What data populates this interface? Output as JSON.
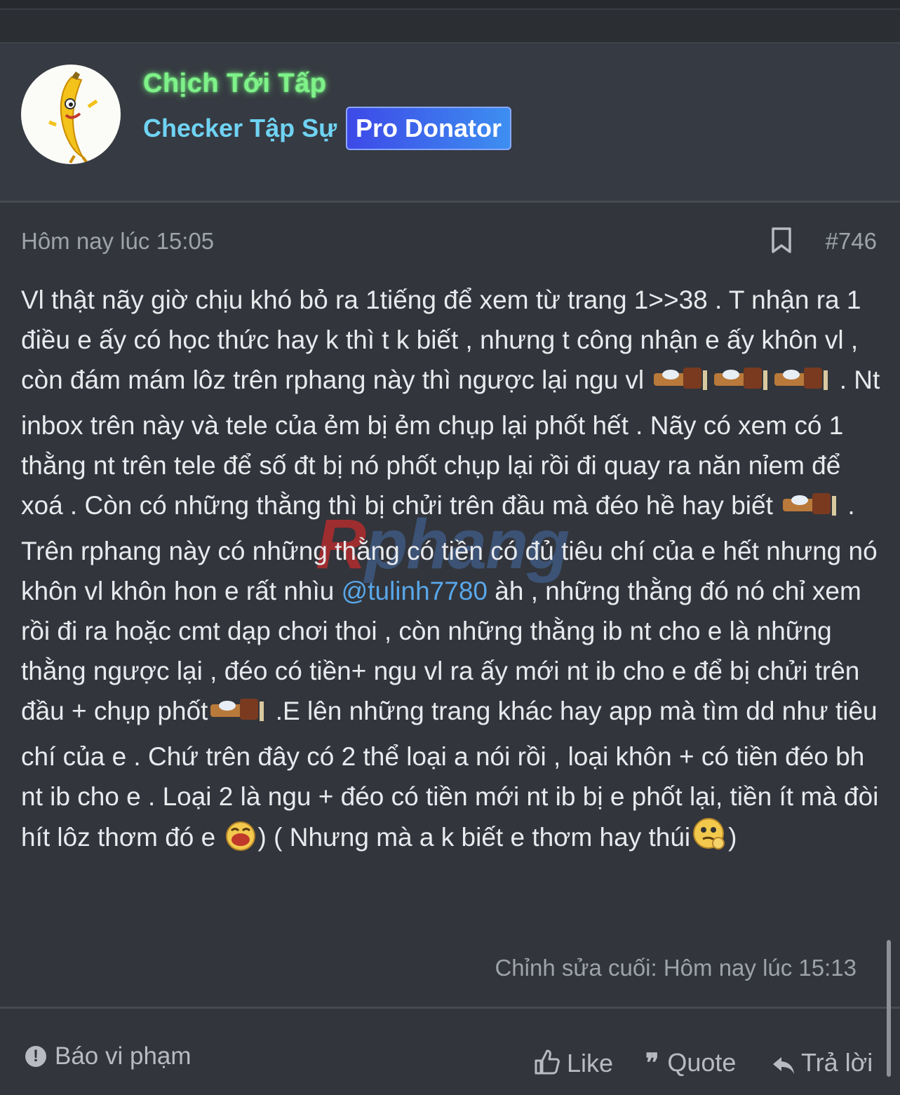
{
  "post": {
    "author": {
      "name": "Chịch Tới Tấp",
      "title": "Checker Tập Sự",
      "badge": "Pro Donator"
    },
    "date": "Hôm nay lúc 15:05",
    "number": "#746",
    "message": {
      "p1": "Vl thật nãy giờ chịu khó bỏ ra 1tiếng để xem từ trang 1>>38 . T nhận ra 1 điều e ấy có học thức hay k thì t k biết , nhưng t công nhận e ấy khôn vl , còn đám mám lôz trên rphang này thì ngược lại ngu vl",
      "p2": " . Nt inbox trên này và tele của ẻm bị ẻm chụp lại phốt hết . Nãy có xem có 1 thằng nt trên tele để số đt bị nó phốt chụp lại rồi đi quay ra năn nỉem để xoá . Còn có những thằng thì bị chửi trên đầu mà đéo hề hay biết",
      "p3": " . Trên rphang này có những thằng có tiền có đủ tiêu chí của e hết nhưng nó khôn vl khôn hon e rất nhìu ",
      "mention": "@tulinh7780",
      "p4": " àh , những thằng đó nó chỉ xem rồi đi ra hoặc cmt dạp chơi thoi , còn những thằng ib nt cho e là những thằng ngược lại , đéo có tiền+ ngu vl ra ấy mới nt ib cho e để bị chửi trên đầu + chụp phốt",
      "p5": " .E lên những trang khác hay app mà tìm dd như tiêu chí của e . Chứ trên đây có 2 thể loại a nói rồi , loại khôn + có tiền đéo bh nt ib cho e . Loại 2 là ngu + đéo có tiền mới nt ib bị e phốt lại, tiền ít mà đòi hít lôz thơm đó e ",
      "p6": ") ( Nhưng mà a k biết e thơm hay thúi",
      "p7": ")"
    },
    "edited": "Chỉnh sửa cuối: Hôm nay lúc 15:13"
  },
  "watermark": {
    "first": "R",
    "rest": "phang"
  },
  "footer": {
    "report_icon": "!",
    "report": "Báo vi phạm",
    "like": "Like",
    "quote_icon": "❞",
    "quote": "Quote",
    "reply_icon": "➦",
    "reply": "Trả lời"
  },
  "icons": {
    "bookmark": "bookmark-icon",
    "like": "thumbs-up-icon",
    "quote": "quote-icon",
    "reply": "reply-icon",
    "report": "alert-icon"
  },
  "colors": {
    "username": "#7ff28a",
    "user_title": "#6fd3f3",
    "badge": "#3d6cee",
    "mention": "#59a7ea"
  }
}
